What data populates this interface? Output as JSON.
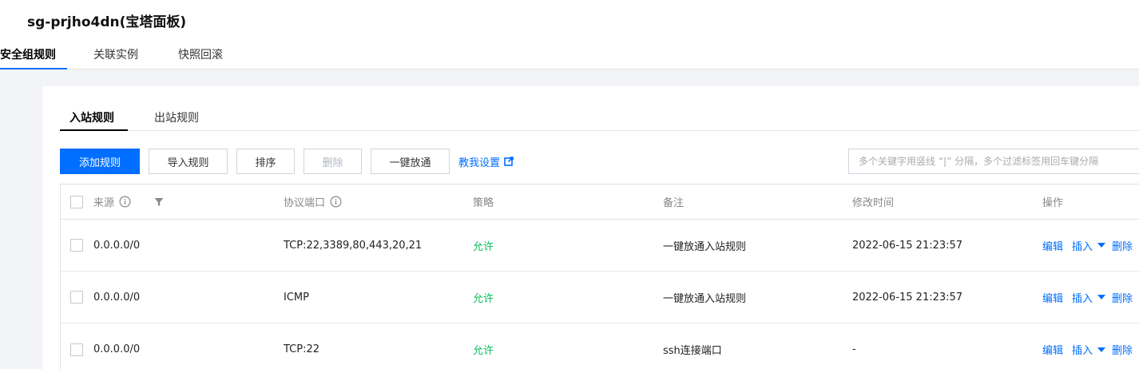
{
  "page": {
    "title": "sg-prjho4dn(宝塔面板)",
    "tabs": [
      "安全组规则",
      "关联实例",
      "快照回滚"
    ]
  },
  "rules": {
    "subtabs": [
      "入站规则",
      "出站规则"
    ],
    "toolbar": {
      "add": "添加规则",
      "import": "导入规则",
      "sort": "排序",
      "delete": "删除",
      "open_all": "一键放通",
      "guide": "教我设置"
    },
    "search": {
      "placeholder": "多个关键字用竖线 “|” 分隔，多个过滤标签用回车键分隔",
      "value": ""
    },
    "table": {
      "headers": {
        "source": "来源",
        "protocol": "协议端口",
        "policy": "策略",
        "note": "备注",
        "time": "修改时间",
        "ops": "操作"
      },
      "rows": [
        {
          "source": "0.0.0.0/0",
          "protocol": "TCP:22,3389,80,443,20,21",
          "policy": "允许",
          "note": "一键放通入站规则",
          "time": "2022-06-15 21:23:57",
          "edit": "编辑",
          "insert": "插入",
          "delete": "删除"
        },
        {
          "source": "0.0.0.0/0",
          "protocol": "ICMP",
          "policy": "允许",
          "note": "一键放通入站规则",
          "time": "2022-06-15 21:23:57",
          "edit": "编辑",
          "insert": "插入",
          "delete": "删除"
        },
        {
          "source": "0.0.0.0/0",
          "protocol": "TCP:22",
          "policy": "允许",
          "note": "ssh连接端口",
          "time": "-",
          "edit": "编辑",
          "insert": "插入",
          "delete": "删除"
        }
      ]
    }
  },
  "colors": {
    "primary": "#006eff",
    "allow": "#0abf5b",
    "background": "#f3f4f7"
  }
}
